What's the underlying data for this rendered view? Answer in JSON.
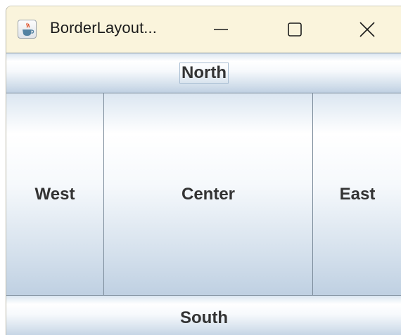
{
  "window": {
    "title": "BorderLayout...",
    "controls": [
      "minimize-icon",
      "maximize-icon",
      "close-icon"
    ],
    "app_icon": "java-cup-icon"
  },
  "buttons": {
    "north": "North",
    "west": "West",
    "center": "Center",
    "east": "East",
    "south": "South"
  },
  "colors": {
    "titlebar": "#faf4dc",
    "button_gradient_light": "#ffffff",
    "button_gradient_dark": "#bfd0e2",
    "border": "#7a8a99",
    "text": "#333333"
  }
}
